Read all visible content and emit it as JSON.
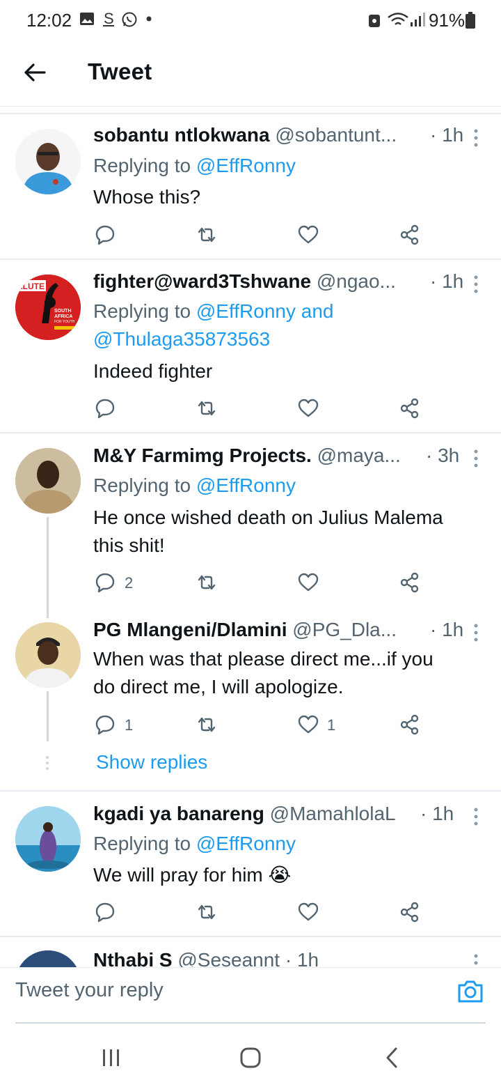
{
  "status_bar": {
    "time": "12:02",
    "battery": "91%",
    "icons": [
      "gallery-icon",
      "s-icon",
      "whatsapp-icon",
      "dot-icon",
      "lock-icon",
      "wifi-icon",
      "signal-icon",
      "battery-icon"
    ]
  },
  "header": {
    "title": "Tweet",
    "back_icon": "arrow-left-icon"
  },
  "tweets": [
    {
      "name": "sobantu ntlokwana",
      "handle": "@sobantunt...",
      "time": "· 1h",
      "reply_prefix": "Replying to",
      "reply_to": "@EffRonny",
      "text": "Whose this?"
    },
    {
      "name": "fighter@ward3Tshwane",
      "handle": "@ngao...",
      "time": "· 1h",
      "reply_prefix": "Replying to",
      "reply_to": "@EffRonny and",
      "reply_to_2": "@Thulaga35873563",
      "text": "Indeed fighter",
      "avatar_text": {
        "top": "ALUTE",
        "line1": "SOUTH",
        "line2": "AFRICA",
        "line3": "FOR YOUTH"
      }
    },
    {
      "name": "M&Y Farmimg Projects.",
      "handle": "@maya...",
      "time": "· 3h",
      "reply_prefix": "Replying to",
      "reply_to": "@EffRonny",
      "text_line1": "He once wished death on Julius Malema",
      "text_line2": "this shit!",
      "reply_count": "2"
    },
    {
      "name": "PG Mlangeni/Dlamini",
      "handle": "@PG_Dla...",
      "time": "· 1h",
      "text_line1": "When was that please direct me...if you",
      "text_line2": "do direct me, I will apologize.",
      "reply_count": "1",
      "like_count": "1"
    },
    {
      "name": "kgadi ya banareng",
      "handle": "@MamahlolaL",
      "time": "· 1h",
      "reply_prefix": "Replying to",
      "reply_to": "@EffRonny",
      "text": "We will pray for him",
      "emoji": "😭"
    },
    {
      "name": "Nthabi S",
      "handle": "@Seseannt",
      "time": "· 1h"
    }
  ],
  "show_replies": "Show replies",
  "reply_bar": {
    "placeholder": "Tweet your reply",
    "camera_icon": "camera-icon"
  },
  "nav": {
    "icons": [
      "recents-icon",
      "home-icon",
      "back-icon"
    ]
  },
  "colors": {
    "accent": "#1d9bf0",
    "secondary_text": "#536471",
    "divider": "#e6ecf0"
  }
}
